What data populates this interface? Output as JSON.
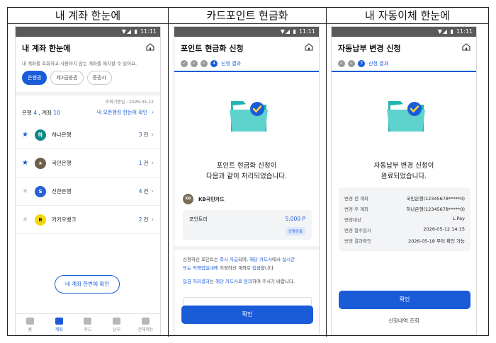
{
  "columns": {
    "col1": "내 계좌 한눈에",
    "col2": "카드포인트 현금화",
    "col3": "내 자동이체 한눈에"
  },
  "status_bar": {
    "time": "11:11",
    "icons": "▼◢ ▮"
  },
  "screen1": {
    "title": "내 계좌 한눈에",
    "subtitle": "내 계좌를 조회하고 사용하지 않는 계좌를 해지할 수 있어요.",
    "chips": [
      "은행권",
      "제2금융권",
      "증권사"
    ],
    "lookup_date": "조회기준일 : 2026-05-12",
    "summary_prefix": "은행 ",
    "bank_count": "4",
    "summary_mid": " , 계좌 ",
    "account_count": "10",
    "open_banking_link": "내 오픈뱅킹 한눈에 확인",
    "banks": [
      {
        "name": "하나은행",
        "count": "3",
        "unit": "건",
        "starred": true,
        "color": "#0a8a82",
        "glyph": "하"
      },
      {
        "name": "국민은행",
        "count": "1",
        "unit": "건",
        "starred": true,
        "color": "#6e5e4c",
        "glyph": "★"
      },
      {
        "name": "신한은행",
        "count": "4",
        "unit": "건",
        "starred": false,
        "color": "#2a5fd6",
        "glyph": "S"
      },
      {
        "name": "카카오뱅크",
        "count": "2",
        "unit": "건",
        "starred": false,
        "color": "#f7d50f",
        "glyph": "B"
      }
    ],
    "confirm_button": "내 계좌 한번에 확인",
    "tabs": [
      "홈",
      "계좌",
      "카드",
      "납부",
      "전체메뉴"
    ]
  },
  "screen2": {
    "title": "포인트 현금화 신청",
    "steps": [
      "✓",
      "✓",
      "✓",
      "4"
    ],
    "current_step_label": "신청 결과",
    "progress": 1.0,
    "message_line1": "포인트 현금화 신청이",
    "message_line2": "다음과 같이 처리되었습니다.",
    "card_logo": "KB",
    "card_name": "KB국민카드",
    "point_label": "포인트리",
    "point_value": "5,000 P",
    "status_badge": "신청완료",
    "note1_a": "신청하신 포인트는 ",
    "note1_b": "즉시 자급",
    "note1_c": "되며, ",
    "note1_d": "해당 카드사",
    "note1_e": "에서 ",
    "note1_f": "실시간",
    "note1_g": "또는 익영업일내에",
    "note1_h": " 지정하신 계좌로 ",
    "note1_i": "입금",
    "note1_j": "합니다.",
    "note2_a": "입금 처리결과",
    "note2_b": "는 ",
    "note2_c": "해당 카드사로 문의",
    "note2_d": "하여 주시기 바랍니다.",
    "confirm_button": "확인"
  },
  "screen3": {
    "title": "자동납부 변경 신청",
    "steps": [
      "✓",
      "✓",
      "3"
    ],
    "current_step_label": "신청 결과",
    "progress": 1.0,
    "message_line1": "자동납부 변경 신청이",
    "message_line2": "완료되었습니다.",
    "details": [
      {
        "k": "변경 전 계좌",
        "v": "국민은행(12345678*****0)"
      },
      {
        "k": "변경 후 계좌",
        "v": "하나은행(12345678*****0)"
      },
      {
        "k": "변경대상",
        "v": "L.Pay"
      },
      {
        "k": "변경 접수일시",
        "v": "2026-05-12  14:15"
      },
      {
        "k": "변경 결과확인",
        "v": "2026-05-18 부터 확인 가능"
      }
    ],
    "confirm_button": "확인",
    "history_link": "신청내역 조회"
  }
}
